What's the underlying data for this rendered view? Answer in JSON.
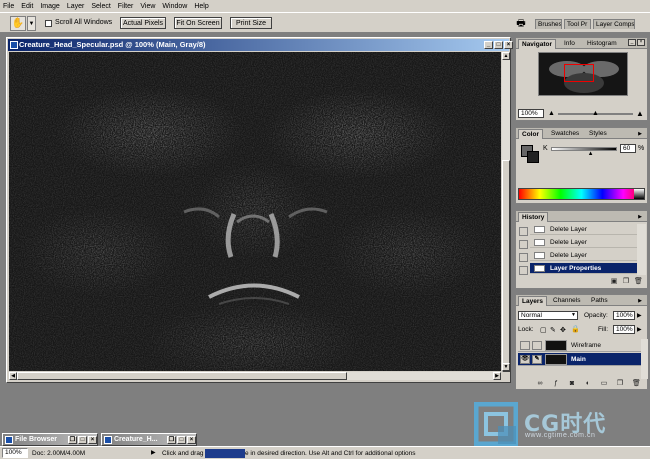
{
  "menu": [
    "File",
    "Edit",
    "Image",
    "Layer",
    "Select",
    "Filter",
    "View",
    "Window",
    "Help"
  ],
  "options": {
    "scroll_all_label": "Scroll All Windows",
    "actual_pixels": "Actual Pixels",
    "fit_on_screen": "Fit On Screen",
    "print_size": "Print Size",
    "well_tabs": [
      "Brushes",
      "Tool Pr",
      "Layer Comps"
    ]
  },
  "document": {
    "title": "Creature_Head_Specular.psd @ 100% (Main, Gray/8)"
  },
  "navigator": {
    "tabs": [
      "Navigator",
      "Info",
      "Histogram"
    ],
    "zoom": "100%"
  },
  "color": {
    "tabs": [
      "Color",
      "Swatches",
      "Styles"
    ],
    "channel": "K",
    "value": "60",
    "unit": "%",
    "slider_fraction": 0.6
  },
  "history": {
    "tab": "History",
    "items": [
      "Delete Layer",
      "Delete Layer",
      "Delete Layer",
      "Layer Properties"
    ]
  },
  "layers": {
    "tabs": [
      "Layers",
      "Channels",
      "Paths"
    ],
    "blend_mode": "Normal",
    "opacity_label": "Opacity:",
    "opacity": "100%",
    "lock_label": "Lock:",
    "fill_label": "Fill:",
    "fill": "100%",
    "items": [
      {
        "name": "Wireframe"
      },
      {
        "name": "Main"
      }
    ]
  },
  "minimized": [
    "File Browser",
    "Creature_H..."
  ],
  "status": {
    "zoom": "100%",
    "doc": "Doc: 2.00M/4.00M",
    "hint_before": "Click and drag",
    "hint_after": "e in desired direction.  Use Alt and Ctrl for additional options"
  },
  "watermark": {
    "text": "CG时代",
    "url": "www.cgtime.com.cn"
  }
}
